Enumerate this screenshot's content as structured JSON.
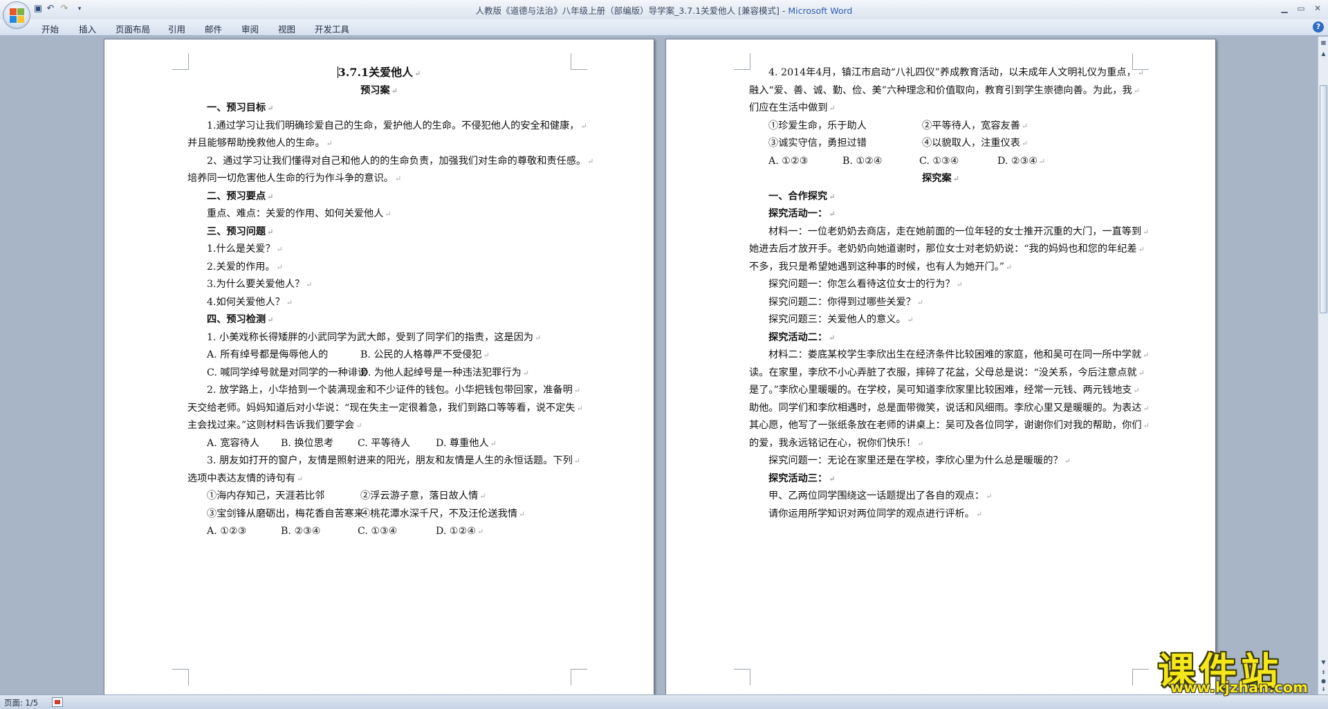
{
  "window": {
    "title": "人教版《道德与法治》八年级上册（部编版）导学案_3.7.1关爱他人 [兼容模式]",
    "app_name": "Microsoft Word",
    "title_separator": " - "
  },
  "ribbon": {
    "tabs": [
      "开始",
      "插入",
      "页面布局",
      "引用",
      "邮件",
      "审阅",
      "视图",
      "开发工具"
    ]
  },
  "status": {
    "page": "页面: 1/5"
  },
  "watermark": {
    "main": "课件站",
    "sub": "www.kjzhan.com"
  },
  "pilcrow": "↵",
  "page1": {
    "lines": [
      {
        "text": "3.7.1关爱他人",
        "style": "title"
      },
      {
        "text": "预习案",
        "style": "heading-center"
      },
      {
        "text": "一、预习目标",
        "style": "heading"
      },
      {
        "text": "1.通过学习让我们明确珍爱自己的生命，爱护他人的生命。不侵犯他人的安全和健康，",
        "style": "indent"
      },
      {
        "text": "并且能够帮助挽救他人的生命。",
        "style": "flush"
      },
      {
        "text": "2、通过学习让我们懂得对自己和他人的的生命负责，加强我们对生命的尊敬和责任感。",
        "style": "indent"
      },
      {
        "text": "培养同一切危害他人生命的行为作斗争的意识。",
        "style": "flush"
      },
      {
        "text": "二、预习要点",
        "style": "heading"
      },
      {
        "text": "重点、难点：关爱的作用、如何关爱他人",
        "style": "indent"
      },
      {
        "text": "三、预习问题",
        "style": "heading"
      },
      {
        "text": "1.什么是关爱？",
        "style": "indent"
      },
      {
        "text": "2.关爱的作用。",
        "style": "indent"
      },
      {
        "text": "3.为什么要关爱他人？",
        "style": "indent"
      },
      {
        "text": "4.如何关爱他人？",
        "style": "indent"
      },
      {
        "text": "四、预习检测",
        "style": "heading"
      },
      {
        "text": "1. 小美戏称长得矮胖的小武同学为武大郎，受到了同学们的指责，这是因为",
        "style": "indent"
      },
      {
        "cols": [
          "A. 所有绰号都是侮辱他人的",
          "B. 公民的人格尊严不受侵犯"
        ],
        "style": "cols2"
      },
      {
        "cols": [
          "C. 喊同学绰号就是对同学的一种诽谤",
          "D. 为他人起绰号是一种违法犯罪行为"
        ],
        "style": "cols2"
      },
      {
        "text": "2. 放学路上，小华拾到一个装满现金和不少证件的钱包。小华把钱包带回家，准备明",
        "style": "indent"
      },
      {
        "text": "天交给老师。妈妈知道后对小华说：“现在失主一定很着急，我们到路口等等看，说不定失",
        "style": "flush"
      },
      {
        "text": "主会找过来。”这则材料告诉我们要学会",
        "style": "flush"
      },
      {
        "cols": [
          "A. 宽容待人",
          "B. 换位思考",
          "C. 平等待人",
          "D. 尊重他人"
        ],
        "style": "cols4"
      },
      {
        "text": "3. 朋友如打开的窗户，友情是照射进来的阳光，朋友和友情是人生的永恒话题。下列",
        "style": "indent"
      },
      {
        "text": "选项中表达友情的诗句有",
        "style": "flush"
      },
      {
        "cols": [
          "①海内存知己，天涯若比邻",
          "②浮云游子意，落日故人情"
        ],
        "style": "cols2"
      },
      {
        "cols": [
          "③宝剑锋从磨砺出，梅花香自苦寒来",
          "④桃花潭水深千尺，不及汪伦送我情"
        ],
        "style": "cols2"
      },
      {
        "cols": [
          "A. ①②③",
          "B. ②③④",
          "C. ①③④",
          "D. ①②④"
        ],
        "style": "cols4"
      }
    ]
  },
  "page2": {
    "lines": [
      {
        "text": "4. 2014年4月，镇江市启动“八礼四仪”养成教育活动，以未成年人文明礼仪为重点，",
        "style": "indent"
      },
      {
        "text": "融入“爱、善、诚、勤、俭、美”六种理念和价值取向，教育引到学生崇德向善。为此，我",
        "style": "flush"
      },
      {
        "text": "们应在生活中做到",
        "style": "flush"
      },
      {
        "cols": [
          "①珍爱生命，乐于助人",
          "②平等待人，宽容友善"
        ],
        "style": "cols2"
      },
      {
        "cols": [
          "③诚实守信，勇担过错",
          "④以貌取人，注重仪表"
        ],
        "style": "cols2"
      },
      {
        "cols": [
          "A. ①②③",
          "B. ①②④",
          "C. ①③④",
          "D. ②③④"
        ],
        "style": "cols4"
      },
      {
        "text": "探究案",
        "style": "heading-center"
      },
      {
        "text": "一、合作探究",
        "style": "heading"
      },
      {
        "text": "探究活动一：",
        "style": "heading"
      },
      {
        "text": "材料一：一位老奶奶去商店，走在她前面的一位年轻的女士推开沉重的大门，一直等到",
        "style": "indent"
      },
      {
        "text": "她进去后才放开手。老奶奶向她道谢时，那位女士对老奶奶说：“我的妈妈也和您的年纪差",
        "style": "flush"
      },
      {
        "text": "不多，我只是希望她遇到这种事的时候，也有人为她开门。”",
        "style": "flush"
      },
      {
        "text": "探究问题一：你怎么看待这位女士的行为？",
        "style": "indent"
      },
      {
        "text": "探究问题二：你得到过哪些关爱？",
        "style": "indent"
      },
      {
        "text": "探究问题三：关爱他人的意义。",
        "style": "indent"
      },
      {
        "text": "探究活动二：",
        "style": "heading"
      },
      {
        "text": "材料二：娄底某校学生李欣出生在经济条件比较困难的家庭，他和吴可在同一所中学就",
        "style": "indent"
      },
      {
        "text": "读。在家里，李欣不小心弄脏了衣服，摔碎了花盆，父母总是说：“没关系，今后注意点就",
        "style": "flush"
      },
      {
        "text": "是了。”李欣心里暖暖的。在学校，吴可知道李欣家里比较困难，经常一元钱、两元钱地支",
        "style": "flush"
      },
      {
        "text": "助他。同学们和李欣相遇时，总是面带微笑，说话和风细雨。李欣心里又是暖暖的。为表达",
        "style": "flush"
      },
      {
        "text": "其心愿，他写了一张纸条放在老师的讲桌上：吴可及各位同学，谢谢你们对我的帮助，你们",
        "style": "flush"
      },
      {
        "text": "的爱，我永远铭记在心，祝你们快乐！",
        "style": "flush"
      },
      {
        "text": "探究问题一：无论在家里还是在学校，李欣心里为什么总是暖暖的？",
        "style": "indent"
      },
      {
        "text": "探究活动三：",
        "style": "heading"
      },
      {
        "text": "甲、乙两位同学围绕这一话题提出了各自的观点：",
        "style": "indent"
      },
      {
        "text": "请你运用所学知识对两位同学的观点进行评析。",
        "style": "indent"
      }
    ]
  }
}
